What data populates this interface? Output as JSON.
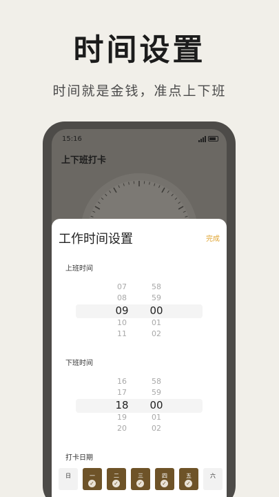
{
  "hero": {
    "title": "时间设置",
    "subtitle": "时间就是金钱，准点上下班"
  },
  "status_bar": {
    "time": "15:16"
  },
  "app": {
    "title": "上下班打卡"
  },
  "sheet": {
    "title": "工作时间设置",
    "done_label": "完成",
    "start": {
      "label": "上班时间",
      "hours": [
        "07",
        "08",
        "09",
        "10",
        "11"
      ],
      "minutes": [
        "58",
        "59",
        "00",
        "01",
        "02"
      ],
      "selected_hour": "09",
      "selected_minute": "00"
    },
    "end": {
      "label": "下班时间",
      "hours": [
        "16",
        "17",
        "18",
        "19",
        "20"
      ],
      "minutes": [
        "58",
        "59",
        "00",
        "01",
        "02"
      ],
      "selected_hour": "18",
      "selected_minute": "00"
    },
    "days": {
      "label": "打卡日期",
      "items": [
        {
          "label": "日",
          "selected": false
        },
        {
          "label": "一",
          "selected": true
        },
        {
          "label": "二",
          "selected": true
        },
        {
          "label": "三",
          "selected": true
        },
        {
          "label": "四",
          "selected": true
        },
        {
          "label": "五",
          "selected": true
        },
        {
          "label": "六",
          "selected": false
        }
      ]
    }
  },
  "colors": {
    "background": "#f1efe9",
    "accent": "#e0a431",
    "day_selected": "#6e5328"
  }
}
